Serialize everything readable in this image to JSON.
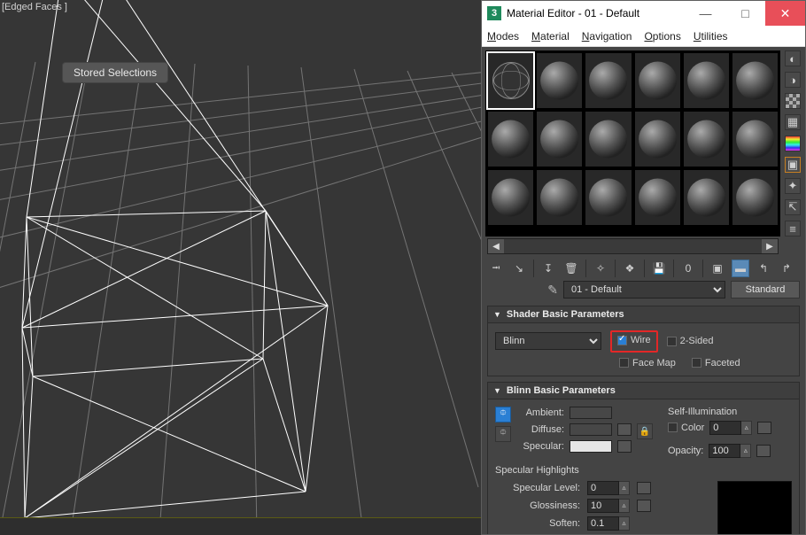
{
  "viewport": {
    "overlay_label": "[Edged Faces ]",
    "pill_label": "Stored Selections"
  },
  "window": {
    "title": "Material Editor - 01 - Default",
    "minimize": "—",
    "restore": "□",
    "close": "✕"
  },
  "menu": {
    "modes": "Modes",
    "material": "Material",
    "navigation": "Navigation",
    "options": "Options",
    "utilities": "Utilities"
  },
  "side_icons": [
    "sample-type",
    "backlight",
    "background",
    "uv-tile",
    "colorbar",
    "video-check",
    "options-icon",
    "preset",
    "material-id"
  ],
  "toolbar": {
    "icons": [
      "get-material",
      "put-to-scene",
      "assign",
      "reset",
      "delete",
      "pick",
      "make-unique",
      "put-to-lib",
      "material-id-channel",
      "show-map",
      "show-end",
      "go-parent",
      "go-forward",
      "tree"
    ]
  },
  "name_row": {
    "material_name": "01 - Default",
    "type_button": "Standard"
  },
  "shader_params": {
    "title": "Shader Basic Parameters",
    "shader_value": "Blinn",
    "wire_label": "Wire",
    "wire_checked": true,
    "twosided_label": "2-Sided",
    "facemap_label": "Face Map",
    "faceted_label": "Faceted"
  },
  "blinn_params": {
    "title": "Blinn Basic Parameters",
    "self_illum_title": "Self-Illumination",
    "color_chk_label": "Color",
    "color_value": "0",
    "opacity_label": "Opacity:",
    "opacity_value": "100",
    "ambient_label": "Ambient:",
    "ambient_color": "#474747",
    "diffuse_label": "Diffuse:",
    "diffuse_color": "#474747",
    "specular_label": "Specular:",
    "specular_color": "#e6e6e6",
    "spec_highlights_title": "Specular Highlights",
    "spec_level_label": "Specular Level:",
    "spec_level_value": "0",
    "gloss_label": "Glossiness:",
    "gloss_value": "10",
    "soften_label": "Soften:",
    "soften_value": "0.1"
  }
}
